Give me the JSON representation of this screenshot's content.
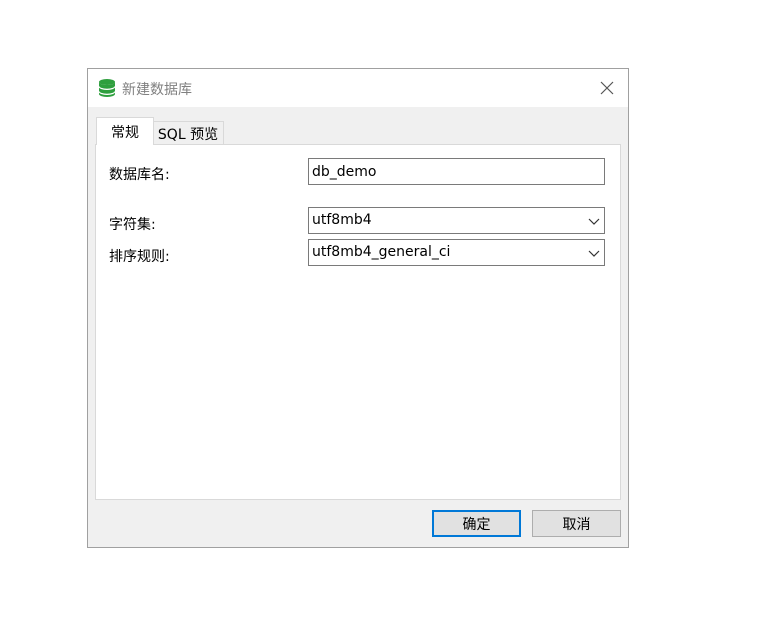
{
  "window": {
    "title": "新建数据库",
    "icon": "database-icon"
  },
  "tabs": [
    {
      "label": "常规",
      "active": true
    },
    {
      "label": "SQL 预览",
      "active": false
    }
  ],
  "form": {
    "db_name_label": "数据库名:",
    "db_name_value": "db_demo",
    "charset_label": "字符集:",
    "charset_value": "utf8mb4",
    "collation_label": "排序规则:",
    "collation_value": "utf8mb4_general_ci"
  },
  "buttons": {
    "ok": "确定",
    "cancel": "取消"
  },
  "colors": {
    "accent": "#0078d7",
    "icon_green": "#2e9f3e"
  }
}
